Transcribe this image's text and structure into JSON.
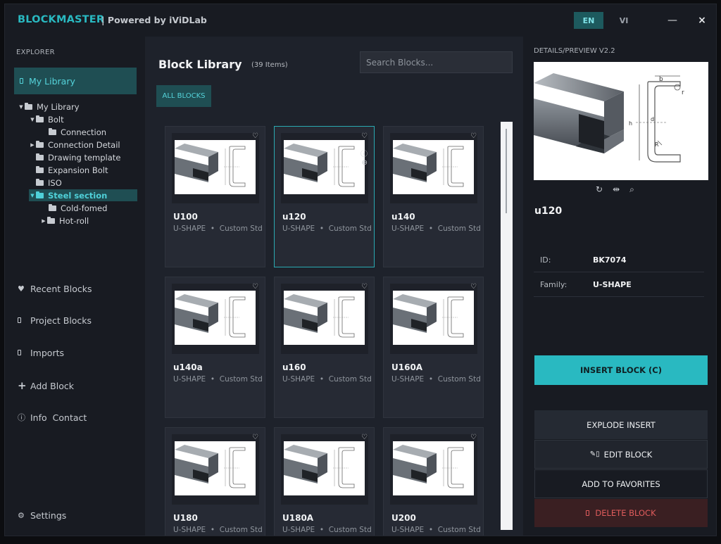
{
  "app": {
    "name": "BLOCKMASTER",
    "powered_by": "| Powered by iViDLab",
    "lang_en": "EN",
    "lang_vi": "VI",
    "minimize": "—",
    "close": "×",
    "accent_color": "#29b9c1"
  },
  "explorer": {
    "title": "EXPLORER",
    "my_library_label": "My Library",
    "tree": [
      {
        "label": "My Library",
        "expanded": true
      },
      {
        "label": "Bolt",
        "expanded": true
      },
      {
        "label": "Connection",
        "expanded": null
      },
      {
        "label": "Connection Detail",
        "expanded": false
      },
      {
        "label": "Drawing template",
        "expanded": null
      },
      {
        "label": "Expansion Bolt",
        "expanded": null
      },
      {
        "label": "ISO",
        "expanded": null
      },
      {
        "label": "Steel section",
        "expanded": true,
        "selected": true
      },
      {
        "label": "Cold-fomed",
        "expanded": null
      },
      {
        "label": "Hot-roll",
        "expanded": false
      }
    ],
    "nav": {
      "recent": "Recent Blocks",
      "project": "Project Blocks",
      "imports": "Imports",
      "add": "Add Block",
      "info": "Info",
      "contact": "Contact",
      "settings": "Settings"
    }
  },
  "library": {
    "title": "Block Library",
    "count": "(39 Items)",
    "search_placeholder": "Search Blocks...",
    "filter_all": "ALL BLOCKS",
    "cards": [
      {
        "name": "U100",
        "shape": "U-SHAPE",
        "std": "Custom Std"
      },
      {
        "name": "u120",
        "shape": "U-SHAPE",
        "std": "Custom Std",
        "selected": true
      },
      {
        "name": "u140",
        "shape": "U-SHAPE",
        "std": "Custom Std"
      },
      {
        "name": "u140a",
        "shape": "U-SHAPE",
        "std": "Custom Std"
      },
      {
        "name": "u160",
        "shape": "U-SHAPE",
        "std": "Custom Std"
      },
      {
        "name": "U160A",
        "shape": "U-SHAPE",
        "std": "Custom Std"
      },
      {
        "name": "U180",
        "shape": "U-SHAPE",
        "std": "Custom Std"
      },
      {
        "name": "U180A",
        "shape": "U-SHAPE",
        "std": "Custom Std"
      },
      {
        "name": "U200",
        "shape": "U-SHAPE",
        "std": "Custom Std"
      }
    ]
  },
  "details": {
    "title": "DETAILS/PREVIEW  V2.2",
    "name": "u120",
    "id_label": "ID:",
    "id_value": "BK7074",
    "family_label": "Family:",
    "family_value": "U-SHAPE",
    "insert": "INSERT BLOCK (C)",
    "explode": "EXPLODE  INSERT",
    "edit": "EDIT BLOCK",
    "favorites": "ADD TO FAVORITES",
    "delete": "DELETE BLOCK"
  }
}
